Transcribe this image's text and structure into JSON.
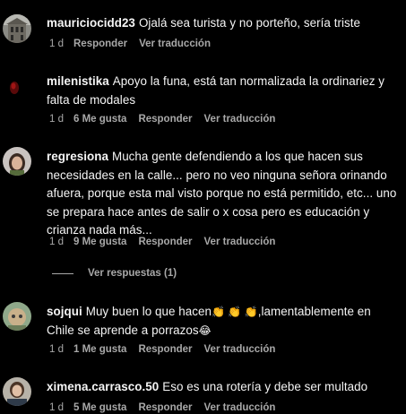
{
  "comments": [
    {
      "username": "mauriciocidd23",
      "text": "Ojalá sea turista y no porteño, sería triste",
      "time": "1 d",
      "likes": "",
      "reply_label": "Responder",
      "translate_label": "Ver traducción"
    },
    {
      "username": "milenistika",
      "text": "Apoyo la funa, está tan normalizada la ordinariez y falta de modales",
      "time": "1 d",
      "likes": "6 Me gusta",
      "reply_label": "Responder",
      "translate_label": "Ver traducción"
    },
    {
      "username": "regresiona",
      "text": "Mucha gente defendiendo a los que hacen sus necesidades en la calle... pero no veo ninguna señora orinando afuera, porque esta mal visto porque no está permitido, etc... uno se prepara hace antes de salir o x cosa pero es educación y crianza nada más...",
      "time": "1 d",
      "likes": "9 Me gusta",
      "reply_label": "Responder",
      "translate_label": "Ver traducción",
      "view_replies": "Ver respuestas (1)"
    },
    {
      "username": "sojqui",
      "text_before": "Muy buen lo que hacen",
      "emojis": "👏 👏 👏",
      "text_after": ",lamentablemente en Chile se aprende a porrazos",
      "end_emoji": "😂",
      "time": "1 d",
      "likes": "1 Me gusta",
      "reply_label": "Responder",
      "translate_label": "Ver traducción"
    },
    {
      "username": "ximena.carrasco.50",
      "text": "Eso es una rotería y debe ser multado",
      "time": "1 d",
      "likes": "5 Me gusta",
      "reply_label": "Responder",
      "translate_label": "Ver traducción"
    }
  ],
  "colors": {
    "background": "#000000",
    "text": "#f5f5f5",
    "secondary": "#a8a8a8"
  }
}
